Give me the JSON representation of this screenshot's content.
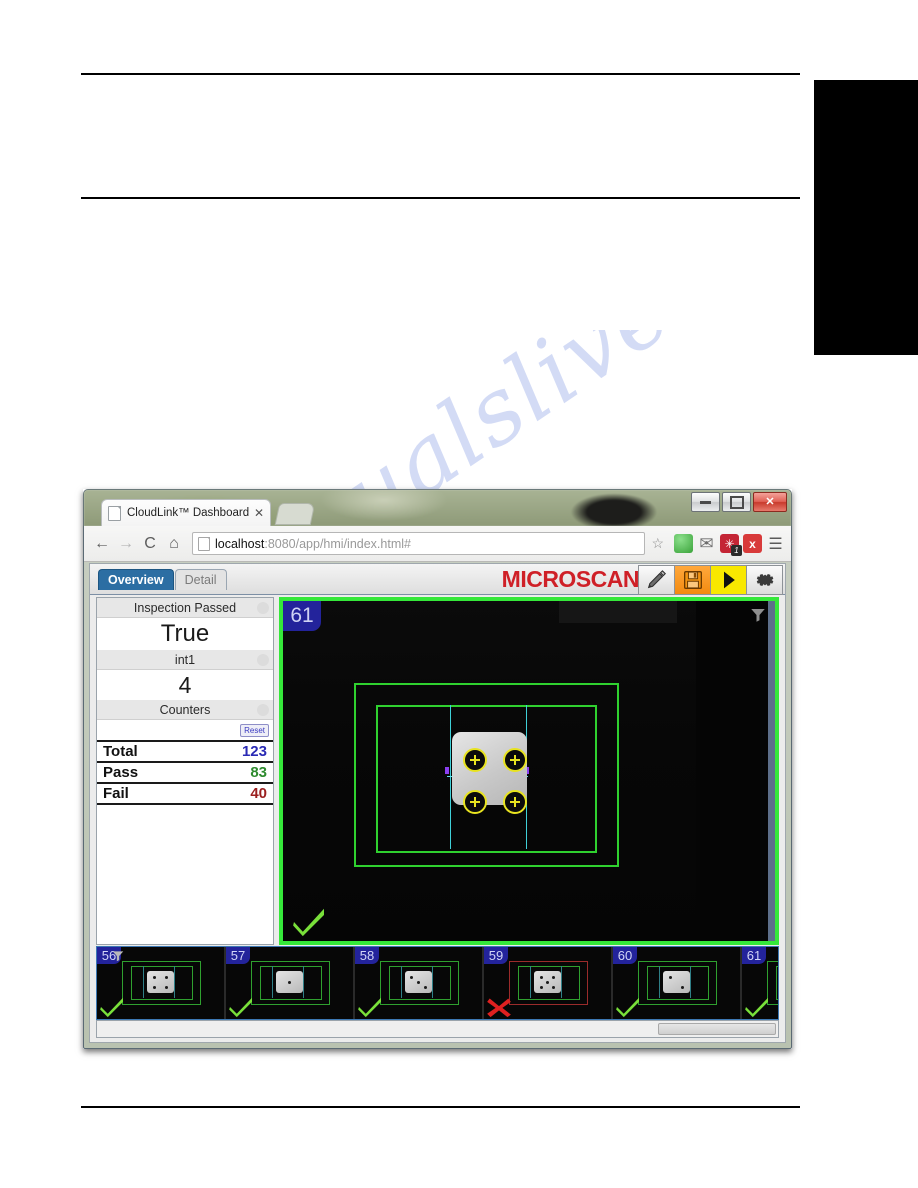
{
  "document": {
    "watermark_text": "manualslive.com"
  },
  "browser": {
    "tab": {
      "title": "CloudLink™ Dashboard",
      "close_label": "✕"
    },
    "window_buttons": {
      "minimize": "minimize",
      "maximize": "maximize",
      "close": "✕"
    },
    "nav": {
      "back": "←",
      "forward": "→",
      "reload": "C",
      "home": "⌂",
      "url_host": "localhost",
      "url_rest": ":8080/app/hmi/index.html#",
      "bookmark_star": "☆"
    },
    "extensions": [
      {
        "name": "green-extension-icon",
        "glyph": ""
      },
      {
        "name": "mail-icon",
        "glyph": "✉"
      },
      {
        "name": "asterisk-extension-icon",
        "glyph": "✳",
        "badge": "1"
      },
      {
        "name": "red-x-extension-icon",
        "glyph": "x"
      },
      {
        "name": "chrome-menu-icon",
        "glyph": "☰"
      }
    ]
  },
  "app": {
    "tabs": [
      {
        "label": "Overview",
        "active": true
      },
      {
        "label": "Detail",
        "active": false
      }
    ],
    "brand": {
      "part1": "MI",
      "part2": "CROSCAN",
      "full": "MICROSCAN"
    },
    "toolbar": [
      {
        "name": "edit-pencil-button",
        "label": "Edit"
      },
      {
        "name": "save-button",
        "label": "Save"
      },
      {
        "name": "run-play-button",
        "label": "Run"
      },
      {
        "name": "settings-gear-button",
        "label": "Settings"
      }
    ],
    "sidebar": {
      "rows": [
        {
          "type": "header",
          "label": "Inspection Passed"
        },
        {
          "type": "value",
          "label": "True"
        },
        {
          "type": "header",
          "label": "int1"
        },
        {
          "type": "value",
          "label": "4"
        },
        {
          "type": "header",
          "label": "Counters"
        }
      ],
      "reset_label": "Reset",
      "counters": [
        {
          "label": "Total",
          "value": "123",
          "color": "#2a2ab4"
        },
        {
          "label": "Pass",
          "value": "83",
          "color": "#2e8b2e"
        },
        {
          "label": "Fail",
          "value": "40",
          "color": "#9b2020"
        }
      ]
    },
    "viewer": {
      "frame_number": "61",
      "result": "pass",
      "filter_icon": "funnel-icon",
      "check_icon": "check-mark"
    },
    "filmstrip": [
      {
        "frame": "56",
        "result": "pass",
        "pips": 4,
        "has_funnel": true
      },
      {
        "frame": "57",
        "result": "pass",
        "pips": 1,
        "has_funnel": false
      },
      {
        "frame": "58",
        "result": "pass",
        "pips": 3,
        "has_funnel": false
      },
      {
        "frame": "59",
        "result": "fail",
        "pips": 5,
        "has_funnel": false
      },
      {
        "frame": "60",
        "result": "pass",
        "pips": 2,
        "has_funnel": false
      },
      {
        "frame": "61",
        "result": "pass",
        "pips": 4,
        "has_funnel": false
      }
    ]
  },
  "colors": {
    "pass_green": "#35e83a",
    "fail_red": "#e02020",
    "brand_red": "#cf2027",
    "accent_blue": "#2c6ea3",
    "badge_blue": "#23239b",
    "save_orange": "#f38a10",
    "play_yellow": "#f9e800"
  }
}
